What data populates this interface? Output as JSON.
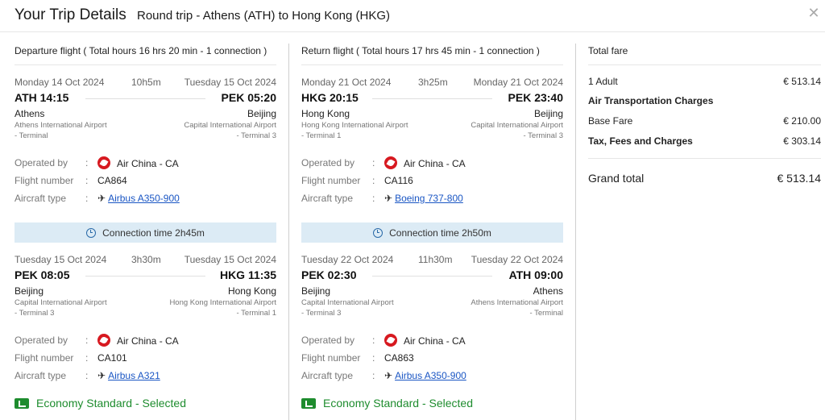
{
  "header": {
    "title": "Your Trip Details",
    "subtitle": "Round trip - Athens (ATH) to Hong Kong (HKG)",
    "close_icon": "close-icon"
  },
  "labels": {
    "operated_by": "Operated by",
    "flight_number": "Flight number",
    "aircraft_type": "Aircraft type",
    "colon": ":"
  },
  "departure": {
    "heading": "Departure flight ( Total hours 16 hrs 20 min - 1 connection )",
    "segments": [
      {
        "dep_date": "Monday 14 Oct 2024",
        "duration": "10h5m",
        "arr_date": "Tuesday 15 Oct 2024",
        "dep_time": "ATH 14:15",
        "arr_time": "PEK 05:20",
        "dep_city": "Athens",
        "arr_city": "Beijing",
        "dep_airport": "Athens International Airport",
        "arr_airport": "Capital International Airport",
        "dep_terminal": "- Terminal",
        "arr_terminal": "- Terminal 3",
        "airline": "Air China - CA",
        "flight": "CA864",
        "aircraft": "Airbus A350-900"
      },
      {
        "dep_date": "Tuesday 15 Oct 2024",
        "duration": "3h30m",
        "arr_date": "Tuesday 15 Oct 2024",
        "dep_time": "PEK 08:05",
        "arr_time": "HKG 11:35",
        "dep_city": "Beijing",
        "arr_city": "Hong Kong",
        "dep_airport": "Capital International Airport",
        "arr_airport": "Hong Kong International Airport",
        "dep_terminal": "- Terminal 3",
        "arr_terminal": "- Terminal 1",
        "airline": "Air China - CA",
        "flight": "CA101",
        "aircraft": "Airbus A321"
      }
    ],
    "connection": "Connection time 2h45m",
    "cabin": "Economy Standard - Selected"
  },
  "return": {
    "heading": "Return flight ( Total hours 17 hrs 45 min - 1 connection )",
    "segments": [
      {
        "dep_date": "Monday 21 Oct 2024",
        "duration": "3h25m",
        "arr_date": "Monday 21 Oct 2024",
        "dep_time": "HKG 20:15",
        "arr_time": "PEK 23:40",
        "dep_city": "Hong Kong",
        "arr_city": "Beijing",
        "dep_airport": "Hong Kong International Airport",
        "arr_airport": "Capital International Airport",
        "dep_terminal": "- Terminal 1",
        "arr_terminal": "- Terminal 3",
        "airline": "Air China - CA",
        "flight": "CA116",
        "aircraft": "Boeing 737-800"
      },
      {
        "dep_date": "Tuesday 22 Oct 2024",
        "duration": "11h30m",
        "arr_date": "Tuesday 22 Oct 2024",
        "dep_time": "PEK 02:30",
        "arr_time": "ATH 09:00",
        "dep_city": "Beijing",
        "arr_city": "Athens",
        "dep_airport": "Capital International Airport",
        "arr_airport": "Athens International Airport",
        "dep_terminal": "- Terminal 3",
        "arr_terminal": "- Terminal",
        "airline": "Air China - CA",
        "flight": "CA863",
        "aircraft": "Airbus A350-900"
      }
    ],
    "connection": "Connection time 2h50m",
    "cabin": "Economy Standard - Selected"
  },
  "fare": {
    "heading": "Total fare",
    "adult_label": "1 Adult",
    "adult_value": "€ 513.14",
    "air_charges": "Air Transportation Charges",
    "base_label": "Base Fare",
    "base_value": "€ 210.00",
    "tax_label": "Tax, Fees and Charges",
    "tax_value": "€ 303.14",
    "grand_label": "Grand total",
    "grand_value": "€ 513.14"
  },
  "colors": {
    "link": "#1a56c4",
    "selected_green": "#1e8c2e",
    "connection_bg": "#dcebf5",
    "airline_red": "#d71920"
  }
}
